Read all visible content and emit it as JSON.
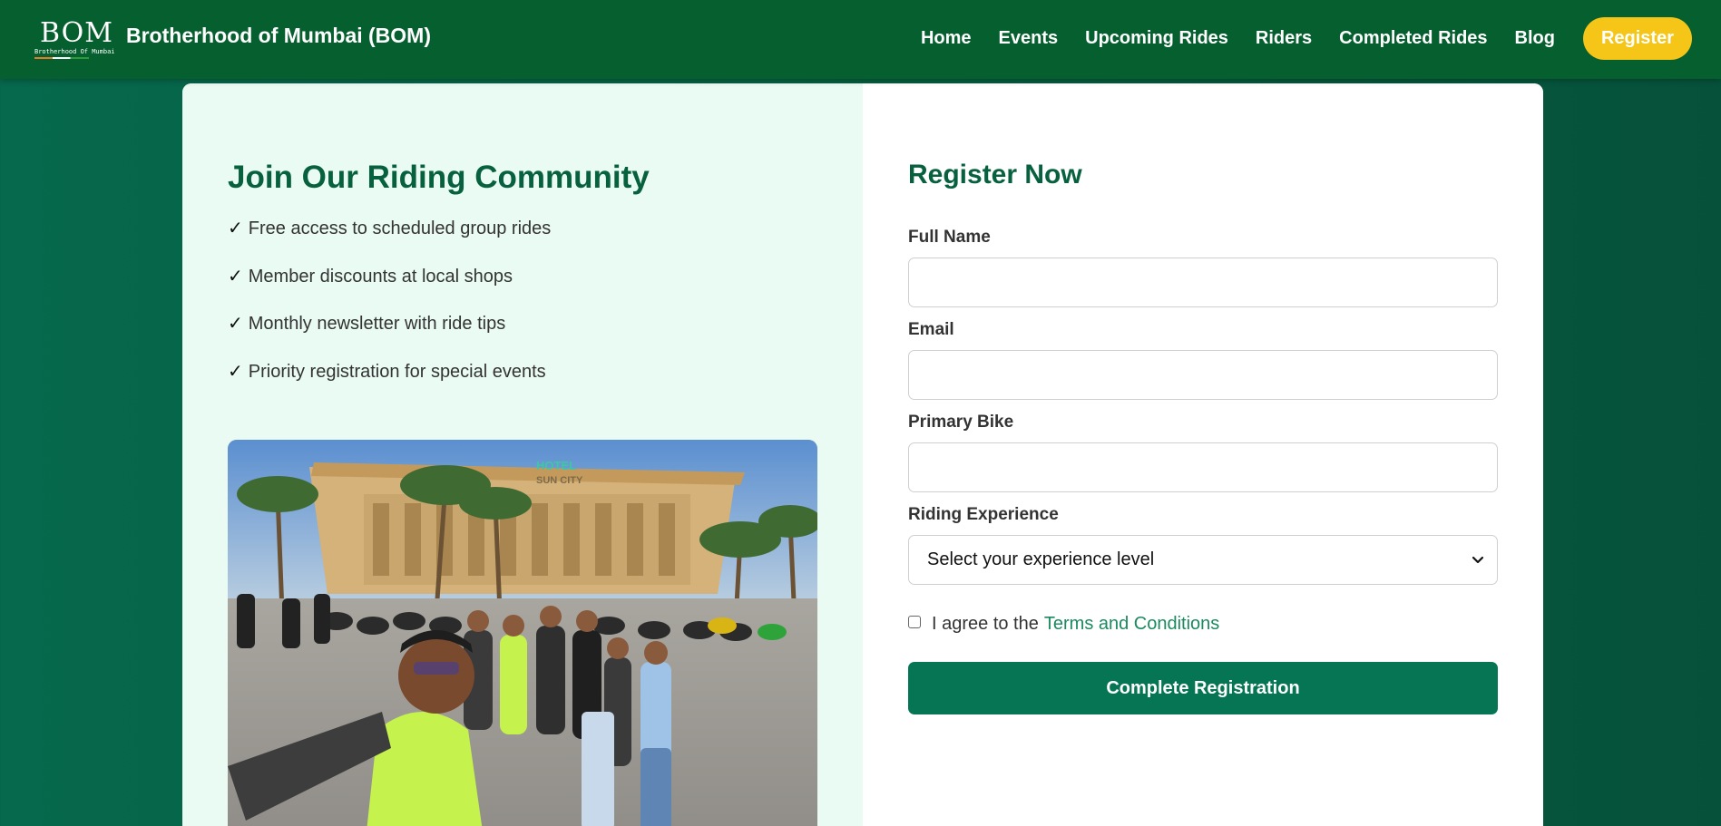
{
  "header": {
    "logo_text": "BOM",
    "logo_subtext": "Brotherhood Of Mumbai",
    "brand": "Brotherhood of Mumbai (BOM)",
    "nav": [
      {
        "label": "Home"
      },
      {
        "label": "Events"
      },
      {
        "label": "Upcoming Rides"
      },
      {
        "label": "Riders"
      },
      {
        "label": "Completed Rides"
      },
      {
        "label": "Blog"
      }
    ],
    "register_label": "Register",
    "accent_color": "#f5c518"
  },
  "left": {
    "title": "Join Our Riding Community",
    "check_glyph": "✓",
    "benefits": [
      "Free access to scheduled group rides",
      "Member discounts at local shops",
      "Monthly newsletter with ride tips",
      "Priority registration for special events"
    ],
    "photo_sign": "HOTEL",
    "photo_sign_2": "SUN CITY"
  },
  "form": {
    "title": "Register Now",
    "full_name_label": "Full Name",
    "full_name_value": "",
    "email_label": "Email",
    "email_value": "",
    "bike_label": "Primary Bike",
    "bike_value": "",
    "experience_label": "Riding Experience",
    "experience_selected": "Select your experience level",
    "agree_text": "I agree to the",
    "terms_link": "Terms and Conditions",
    "agree_checked": false,
    "submit_label": "Complete Registration",
    "primary_color": "#067553"
  }
}
